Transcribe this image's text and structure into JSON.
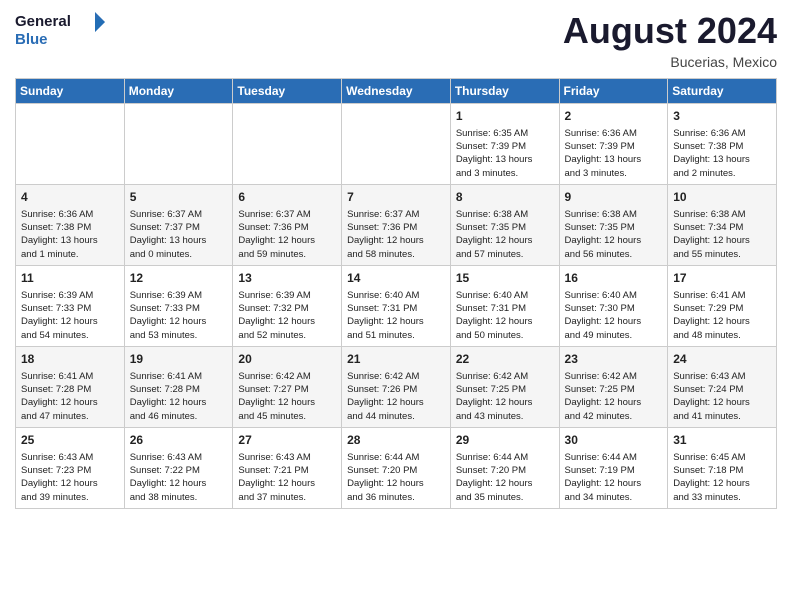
{
  "header": {
    "logo_line1": "General",
    "logo_line2": "Blue",
    "month_year": "August 2024",
    "location": "Bucerias, Mexico"
  },
  "days_of_week": [
    "Sunday",
    "Monday",
    "Tuesday",
    "Wednesday",
    "Thursday",
    "Friday",
    "Saturday"
  ],
  "weeks": [
    [
      {
        "day": "",
        "info": ""
      },
      {
        "day": "",
        "info": ""
      },
      {
        "day": "",
        "info": ""
      },
      {
        "day": "",
        "info": ""
      },
      {
        "day": "1",
        "info": "Sunrise: 6:35 AM\nSunset: 7:39 PM\nDaylight: 13 hours\nand 3 minutes."
      },
      {
        "day": "2",
        "info": "Sunrise: 6:36 AM\nSunset: 7:39 PM\nDaylight: 13 hours\nand 3 minutes."
      },
      {
        "day": "3",
        "info": "Sunrise: 6:36 AM\nSunset: 7:38 PM\nDaylight: 13 hours\nand 2 minutes."
      }
    ],
    [
      {
        "day": "4",
        "info": "Sunrise: 6:36 AM\nSunset: 7:38 PM\nDaylight: 13 hours\nand 1 minute."
      },
      {
        "day": "5",
        "info": "Sunrise: 6:37 AM\nSunset: 7:37 PM\nDaylight: 13 hours\nand 0 minutes."
      },
      {
        "day": "6",
        "info": "Sunrise: 6:37 AM\nSunset: 7:36 PM\nDaylight: 12 hours\nand 59 minutes."
      },
      {
        "day": "7",
        "info": "Sunrise: 6:37 AM\nSunset: 7:36 PM\nDaylight: 12 hours\nand 58 minutes."
      },
      {
        "day": "8",
        "info": "Sunrise: 6:38 AM\nSunset: 7:35 PM\nDaylight: 12 hours\nand 57 minutes."
      },
      {
        "day": "9",
        "info": "Sunrise: 6:38 AM\nSunset: 7:35 PM\nDaylight: 12 hours\nand 56 minutes."
      },
      {
        "day": "10",
        "info": "Sunrise: 6:38 AM\nSunset: 7:34 PM\nDaylight: 12 hours\nand 55 minutes."
      }
    ],
    [
      {
        "day": "11",
        "info": "Sunrise: 6:39 AM\nSunset: 7:33 PM\nDaylight: 12 hours\nand 54 minutes."
      },
      {
        "day": "12",
        "info": "Sunrise: 6:39 AM\nSunset: 7:33 PM\nDaylight: 12 hours\nand 53 minutes."
      },
      {
        "day": "13",
        "info": "Sunrise: 6:39 AM\nSunset: 7:32 PM\nDaylight: 12 hours\nand 52 minutes."
      },
      {
        "day": "14",
        "info": "Sunrise: 6:40 AM\nSunset: 7:31 PM\nDaylight: 12 hours\nand 51 minutes."
      },
      {
        "day": "15",
        "info": "Sunrise: 6:40 AM\nSunset: 7:31 PM\nDaylight: 12 hours\nand 50 minutes."
      },
      {
        "day": "16",
        "info": "Sunrise: 6:40 AM\nSunset: 7:30 PM\nDaylight: 12 hours\nand 49 minutes."
      },
      {
        "day": "17",
        "info": "Sunrise: 6:41 AM\nSunset: 7:29 PM\nDaylight: 12 hours\nand 48 minutes."
      }
    ],
    [
      {
        "day": "18",
        "info": "Sunrise: 6:41 AM\nSunset: 7:28 PM\nDaylight: 12 hours\nand 47 minutes."
      },
      {
        "day": "19",
        "info": "Sunrise: 6:41 AM\nSunset: 7:28 PM\nDaylight: 12 hours\nand 46 minutes."
      },
      {
        "day": "20",
        "info": "Sunrise: 6:42 AM\nSunset: 7:27 PM\nDaylight: 12 hours\nand 45 minutes."
      },
      {
        "day": "21",
        "info": "Sunrise: 6:42 AM\nSunset: 7:26 PM\nDaylight: 12 hours\nand 44 minutes."
      },
      {
        "day": "22",
        "info": "Sunrise: 6:42 AM\nSunset: 7:25 PM\nDaylight: 12 hours\nand 43 minutes."
      },
      {
        "day": "23",
        "info": "Sunrise: 6:42 AM\nSunset: 7:25 PM\nDaylight: 12 hours\nand 42 minutes."
      },
      {
        "day": "24",
        "info": "Sunrise: 6:43 AM\nSunset: 7:24 PM\nDaylight: 12 hours\nand 41 minutes."
      }
    ],
    [
      {
        "day": "25",
        "info": "Sunrise: 6:43 AM\nSunset: 7:23 PM\nDaylight: 12 hours\nand 39 minutes."
      },
      {
        "day": "26",
        "info": "Sunrise: 6:43 AM\nSunset: 7:22 PM\nDaylight: 12 hours\nand 38 minutes."
      },
      {
        "day": "27",
        "info": "Sunrise: 6:43 AM\nSunset: 7:21 PM\nDaylight: 12 hours\nand 37 minutes."
      },
      {
        "day": "28",
        "info": "Sunrise: 6:44 AM\nSunset: 7:20 PM\nDaylight: 12 hours\nand 36 minutes."
      },
      {
        "day": "29",
        "info": "Sunrise: 6:44 AM\nSunset: 7:20 PM\nDaylight: 12 hours\nand 35 minutes."
      },
      {
        "day": "30",
        "info": "Sunrise: 6:44 AM\nSunset: 7:19 PM\nDaylight: 12 hours\nand 34 minutes."
      },
      {
        "day": "31",
        "info": "Sunrise: 6:45 AM\nSunset: 7:18 PM\nDaylight: 12 hours\nand 33 minutes."
      }
    ]
  ]
}
